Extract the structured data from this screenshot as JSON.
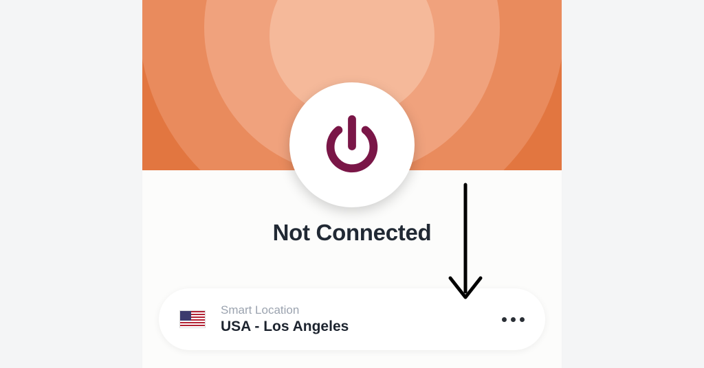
{
  "status": {
    "text": "Not Connected"
  },
  "location": {
    "typeLabel": "Smart Location",
    "name": "USA - Los Angeles",
    "flag": "us"
  },
  "colors": {
    "accent": "#7a1647",
    "heroBase": "#cf6a43"
  },
  "icons": {
    "power": "power-icon",
    "more": "more-icon",
    "arrow": "down-arrow-annotation"
  }
}
